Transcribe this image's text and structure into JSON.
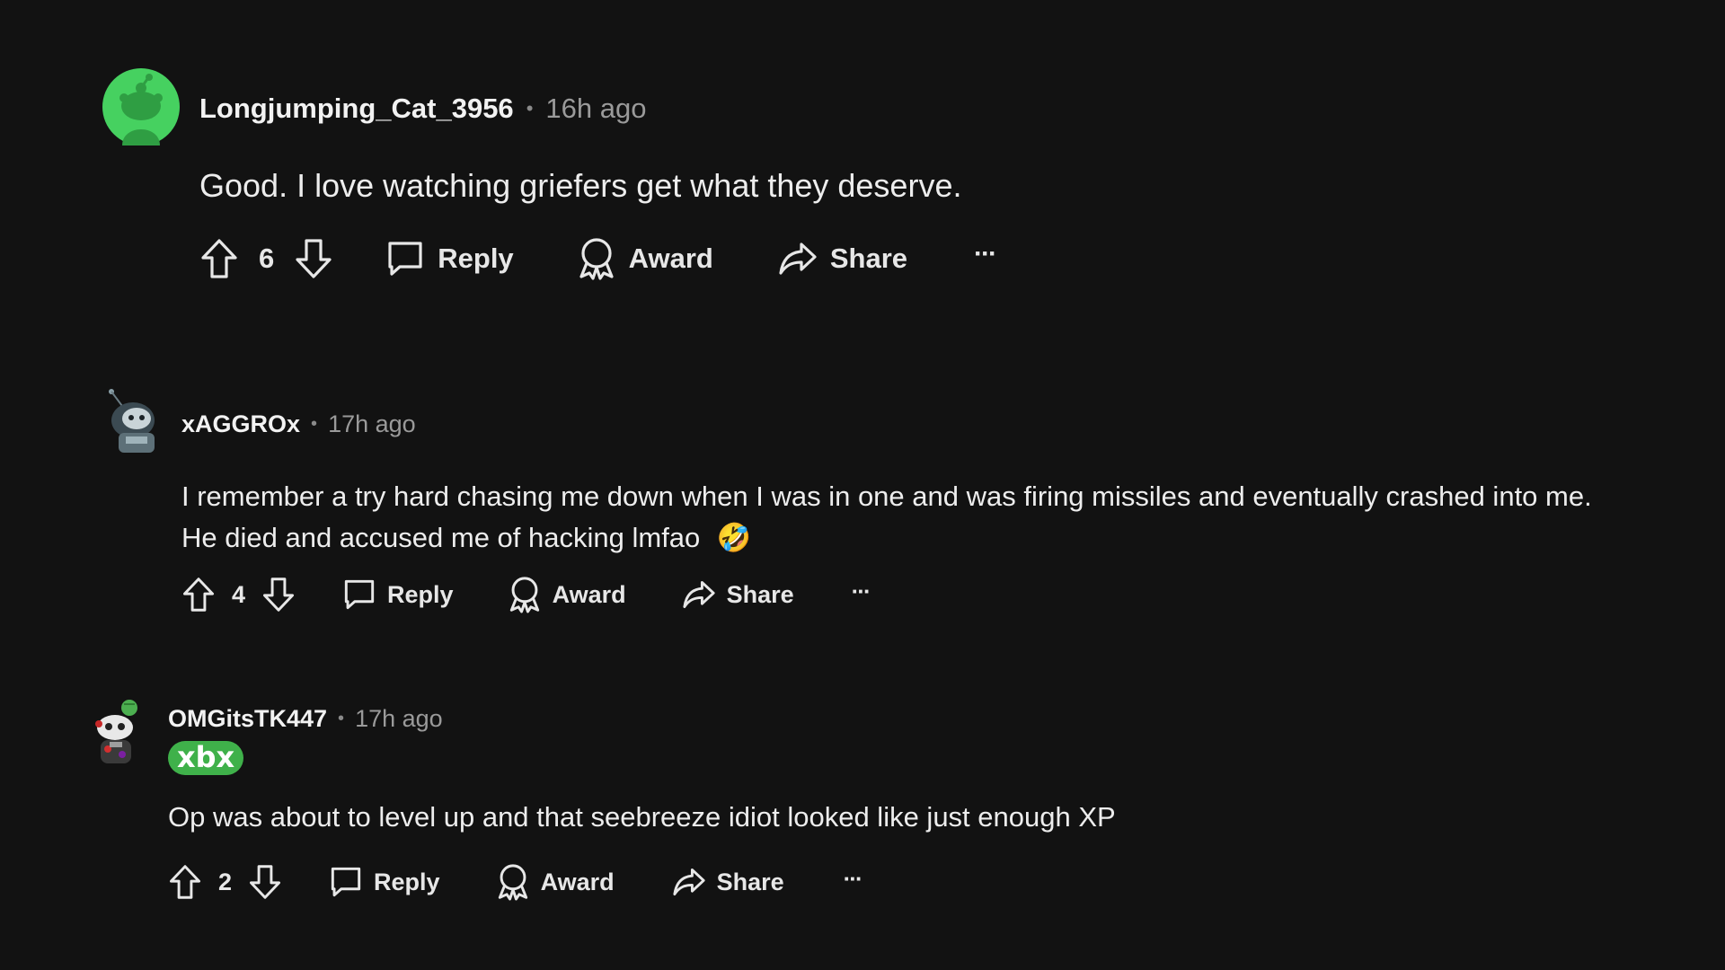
{
  "comments": [
    {
      "username": "Longjumping_Cat_3956",
      "time": "16h ago",
      "separator": "•",
      "text": "Good. I love watching griefers get what they deserve.",
      "score": "6",
      "reply_label": "Reply",
      "award_label": "Award",
      "share_label": "Share",
      "more_label": "···",
      "avatar_color": "#46d160"
    },
    {
      "username": "xAGGROx",
      "time": "17h ago",
      "separator": "•",
      "text_line1": "I remember a try hard chasing me down when I was in one and was firing missiles and eventually crashed into me.",
      "text_line2": "He died and accused me of hacking lmfao",
      "emoji": "🤣",
      "score": "4",
      "reply_label": "Reply",
      "award_label": "Award",
      "share_label": "Share",
      "more_label": "···"
    },
    {
      "username": "OMGitsTK447",
      "time": "17h ago",
      "separator": "•",
      "flair": "xbx",
      "text": "Op was about to level up and that seebreeze idiot looked like just enough XP",
      "score": "2",
      "reply_label": "Reply",
      "award_label": "Award",
      "share_label": "Share",
      "more_label": "···",
      "flair_color": "#3fb14a"
    }
  ],
  "colors": {
    "background": "#121212",
    "text": "#e7e7e7",
    "muted": "#9a9a9a"
  }
}
